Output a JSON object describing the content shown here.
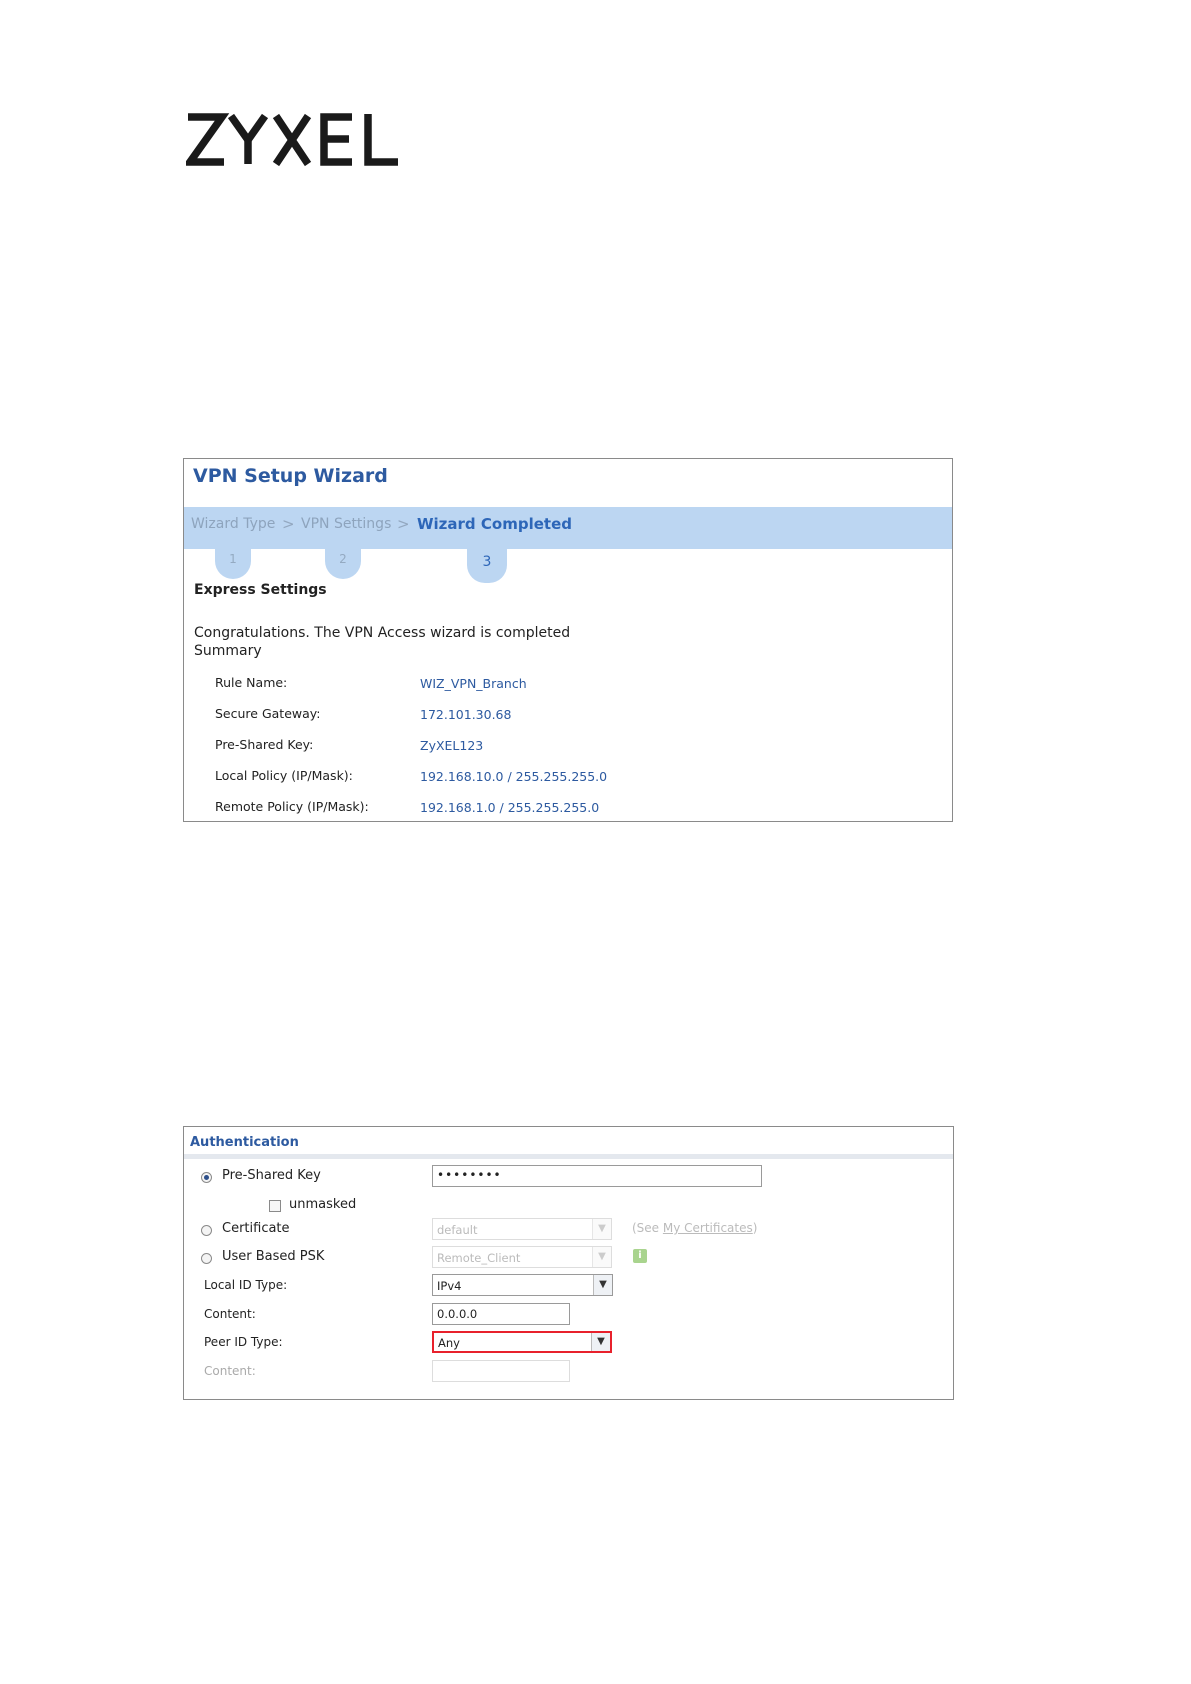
{
  "brand": {
    "logo_text": "ZYXEL"
  },
  "wizard": {
    "title": "VPN Setup Wizard",
    "steps": [
      {
        "label": "Wizard Type",
        "number": "1"
      },
      {
        "label": "VPN Settings",
        "number": "2"
      },
      {
        "label": "Wizard Completed",
        "number": "3"
      }
    ],
    "step_separator": ">",
    "section_title": "Express Settings",
    "message": "Congratulations. The VPN Access wizard is completed",
    "summary_title": "Summary",
    "summary": [
      {
        "label": "Rule Name:",
        "value": "WIZ_VPN_Branch"
      },
      {
        "label": "Secure Gateway:",
        "value": "172.101.30.68"
      },
      {
        "label": "Pre-Shared Key:",
        "value": "ZyXEL123"
      },
      {
        "label": "Local Policy (IP/Mask):",
        "value": "192.168.10.0 / 255.255.255.0"
      },
      {
        "label": "Remote Policy (IP/Mask):",
        "value": "192.168.1.0 / 255.255.255.0"
      }
    ]
  },
  "authentication": {
    "title": "Authentication",
    "pre_shared_key": {
      "label": "Pre-Shared Key",
      "value": "••••••••",
      "selected": true
    },
    "unmasked": {
      "label": "unmasked",
      "checked": false
    },
    "certificate": {
      "label": "Certificate",
      "value": "default",
      "note_prefix": "(See ",
      "note_link": "My Certificates",
      "note_suffix": ")"
    },
    "user_based_psk": {
      "label": "User Based PSK",
      "value": "Remote_Client",
      "info_icon": "i"
    },
    "local_id_type": {
      "label": "Local ID Type:",
      "value": "IPv4"
    },
    "local_content": {
      "label": "Content:",
      "value": "0.0.0.0"
    },
    "peer_id_type": {
      "label": "Peer ID Type:",
      "value": "Any"
    },
    "peer_content": {
      "label": "Content:",
      "value": ""
    },
    "highlight_color": "#e8212c",
    "accent_color": "#2d5aa0"
  }
}
